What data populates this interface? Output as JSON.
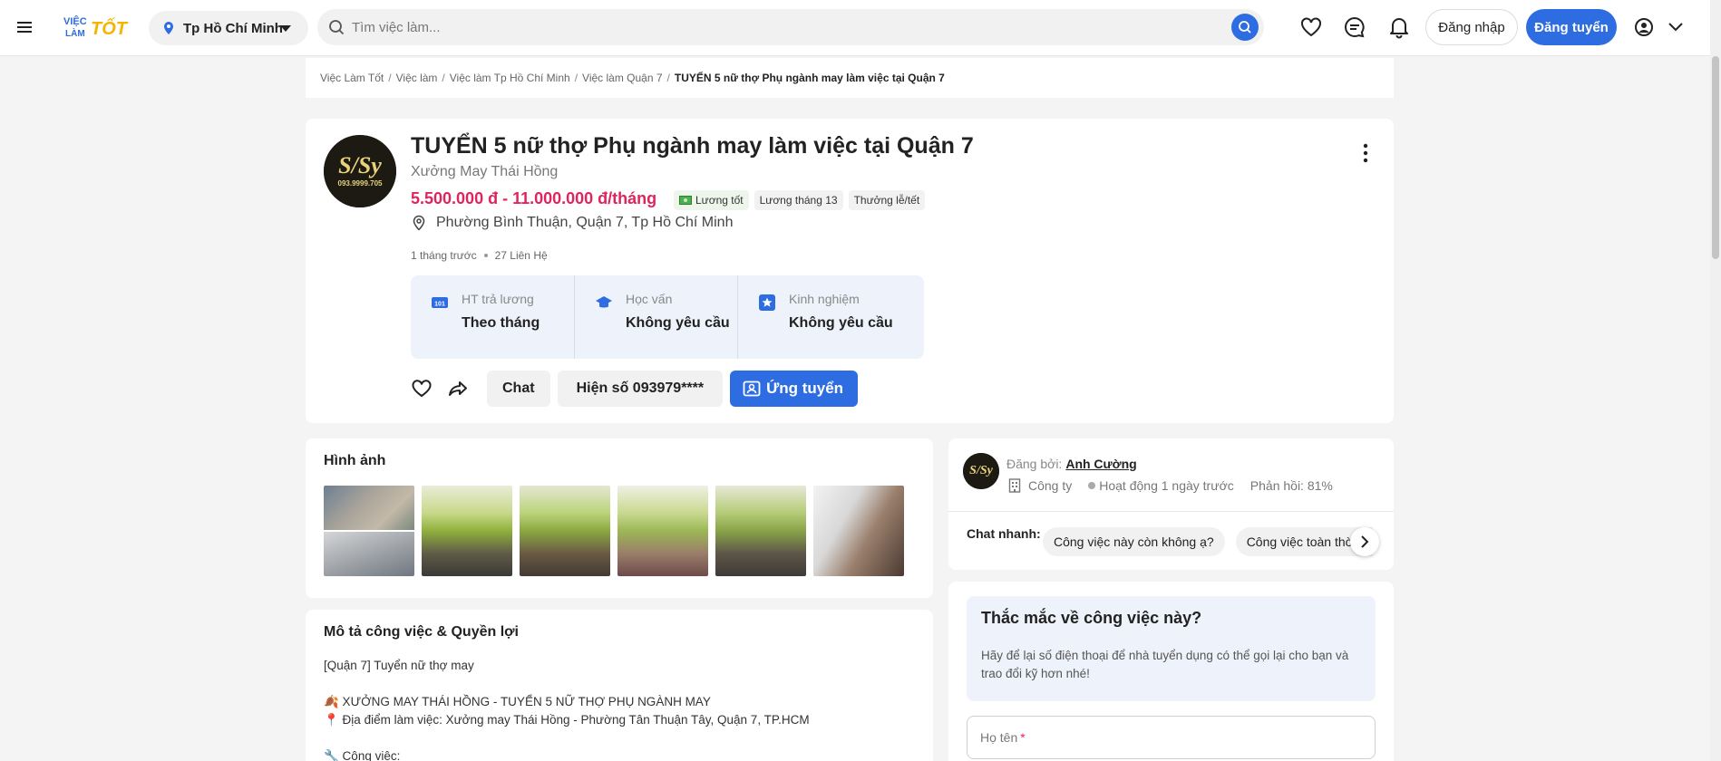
{
  "header": {
    "brand": "VIỆC LÀM TỐT",
    "location": "Tp Hồ Chí Minh",
    "search_placeholder": "Tìm việc làm...",
    "login_label": "Đăng nhập",
    "post_label": "Đăng tuyển"
  },
  "breadcrumb": {
    "items": [
      "Việc Làm Tốt",
      "Việc làm",
      "Việc làm Tp Hồ Chí Minh",
      "Việc làm Quận 7"
    ],
    "current": "TUYỂN 5 nữ thợ Phụ ngành may làm việc tại Quận 7"
  },
  "job": {
    "logo_text": "S/Sy",
    "logo_phone": "093.9999.705",
    "title": "TUYỂN 5 nữ thợ Phụ ngành may làm việc tại Quận 7",
    "company": "Xưởng May Thái Hồng",
    "salary": "5.500.000 đ - 11.000.000 đ/tháng",
    "tags": [
      "Lương tốt",
      "Lương tháng 13",
      "Thưởng lễ/tết"
    ],
    "address": "Phường Bình Thuận, Quận 7, Tp Hồ Chí Minh",
    "posted": "1 tháng trước",
    "contacts": "27 Liên Hệ",
    "info": [
      {
        "label": "HT trả lương",
        "value": "Theo tháng"
      },
      {
        "label": "Học vấn",
        "value": "Không yêu cầu"
      },
      {
        "label": "Kinh nghiệm",
        "value": "Không yêu cầu"
      }
    ],
    "actions": {
      "chat": "Chat",
      "phone": "Hiện số 093979****",
      "apply": "Ứng tuyển"
    }
  },
  "images": {
    "title": "Hình ảnh"
  },
  "description": {
    "title": "Mô tả công việc & Quyền lợi",
    "lines": [
      "[Quận 7] Tuyển nữ thợ may",
      "",
      "🍂 XƯỞNG MAY THÁI HỒNG - TUYỂN 5 NỮ THỢ PHỤ NGÀNH MAY",
      "📍 Địa điểm làm việc: Xưởng may Thái Hồng - Phường Tân Thuận Tây, Quận 7, TP.HCM",
      "",
      "🔧 Công việc:"
    ]
  },
  "poster": {
    "posted_by_label": "Đăng bởi:",
    "name": "Anh Cường",
    "type": "Công ty",
    "activity": "Hoạt động 1 ngày trước",
    "response": "Phản hồi: 81%",
    "quick_chat_label": "Chat nhanh:",
    "quick_chats": [
      "Công việc này còn không ạ?",
      "Công việc toàn thời gian hay bán thời gian?"
    ]
  },
  "question": {
    "title": "Thắc mắc về công việc này?",
    "text": "Hãy để lại số điện thoại để nhà tuyển dụng có thể gọi lại cho bạn và trao đổi kỹ hơn nhé!",
    "name_label": "Họ tên",
    "required_mark": "*"
  },
  "colors": {
    "primary": "#2e6de1",
    "salary": "#e0245e",
    "brand_yellow": "#f5b400",
    "info_bg": "#eef3fb"
  }
}
